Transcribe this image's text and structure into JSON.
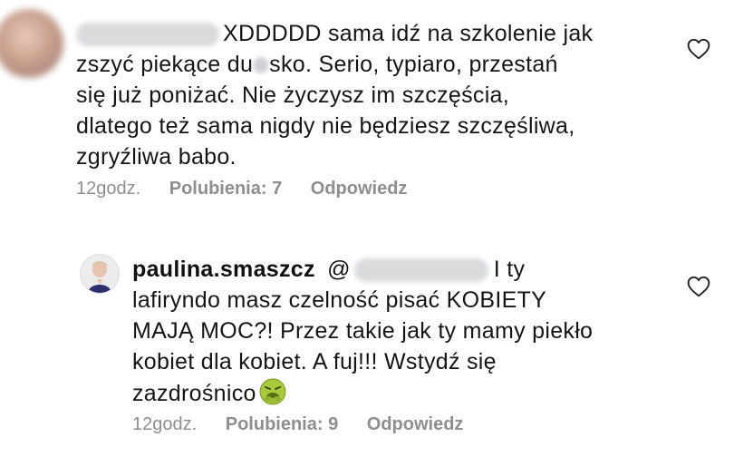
{
  "comment1": {
    "lines": [
      "XDDDDD sama idź na szkolenie jak",
      "zszyć piekące du",
      "sko. Serio, typiaro, przestań",
      "się już poniżać. Nie życzysz im szczęścia,",
      "dlatego też sama nigdy nie będziesz szczęśliwa,",
      "zgryźliwa babo."
    ],
    "time": "12godz.",
    "likes": "Polubienia: 7",
    "reply": "Odpowiedz"
  },
  "comment2": {
    "username": "paulina.smaszcz",
    "at": "@",
    "lines": [
      "I ty",
      "lafiryndo masz czelność pisać KOBIETY",
      "MAJĄ MOC?! Przez takie jak ty mamy piekło",
      "kobiet dla kobiet. A fuj!!! Wstydź się",
      "zazdrośnico"
    ],
    "time": "12godz.",
    "likes": "Polubienia: 9",
    "reply": "Odpowiedz"
  },
  "icons": {
    "like": "heart-outline-icon",
    "emoji": "nauseated-face-emoji"
  },
  "colors": {
    "text": "#151515",
    "meta": "#8e8e8e",
    "blur": "#d9dadc"
  }
}
